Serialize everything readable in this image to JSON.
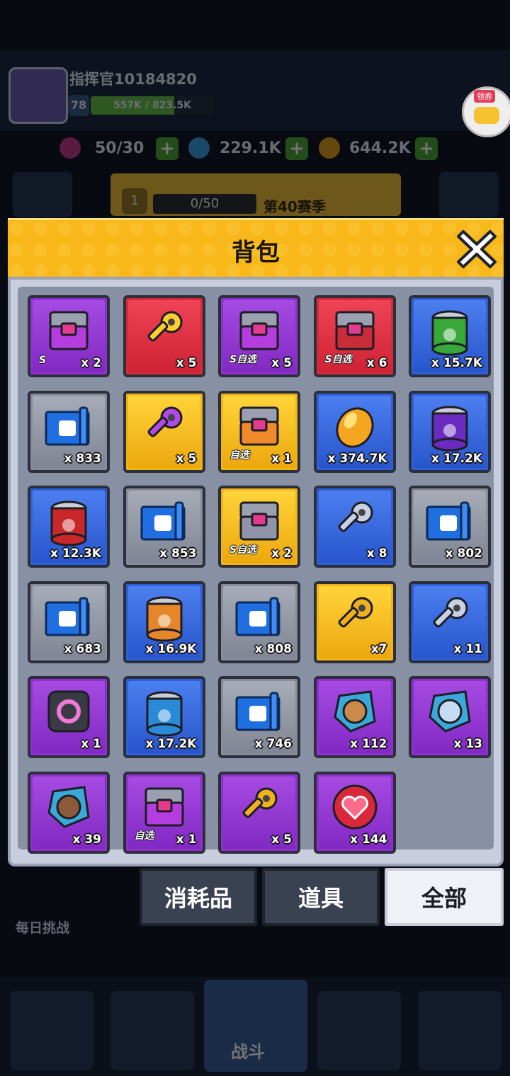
{
  "player": {
    "name": "指挥官10184820",
    "level": "78",
    "xp_text": "557K / 823.5K",
    "xp_fraction": 0.68
  },
  "resources": [
    {
      "icon": "energy-icon",
      "value": "50/30",
      "color": "#c43a8a"
    },
    {
      "icon": "diamond-icon",
      "value": "229.1K",
      "color": "#3aa0e8"
    },
    {
      "icon": "coin-icon",
      "value": "644.2K",
      "color": "#e0a020"
    }
  ],
  "gift": {
    "tag": "领券"
  },
  "season": {
    "level": "1",
    "progress": "0/50",
    "label": "第40赛季"
  },
  "backpack": {
    "title": "背包",
    "items": [
      {
        "icon": "s-chest-icon",
        "qty": "x 2",
        "tag": "S",
        "rarity": "purple"
      },
      {
        "icon": "scepter-key-icon",
        "qty": "x 5",
        "tag": "",
        "rarity": "red"
      },
      {
        "icon": "s-select-chest-icon",
        "qty": "x 5",
        "tag": "S自选",
        "rarity": "purple"
      },
      {
        "icon": "s-select-chest-red-icon",
        "qty": "x 6",
        "tag": "S自选",
        "rarity": "red"
      },
      {
        "icon": "green-leaf-can-icon",
        "qty": "x 15.7K",
        "tag": "",
        "rarity": "blue"
      },
      {
        "icon": "armor-blueprint-icon",
        "qty": "x 833",
        "tag": "",
        "rarity": "gray"
      },
      {
        "icon": "purple-key-icon",
        "qty": "x 5",
        "tag": "",
        "rarity": "gold"
      },
      {
        "icon": "orange-select-chest-icon",
        "qty": "x 1",
        "tag": "自选",
        "rarity": "gold"
      },
      {
        "icon": "gold-bean-icon",
        "qty": "x 374.7K",
        "tag": "",
        "rarity": "blue"
      },
      {
        "icon": "purple-moon-can-icon",
        "qty": "x 17.2K",
        "tag": "",
        "rarity": "blue"
      },
      {
        "icon": "red-fire-can-icon",
        "qty": "x 12.3K",
        "tag": "",
        "rarity": "blue"
      },
      {
        "icon": "boot-blueprint-icon",
        "qty": "x 853",
        "tag": "",
        "rarity": "gray"
      },
      {
        "icon": "gold-s-select-chest-icon",
        "qty": "x 2",
        "tag": "S自选",
        "rarity": "gold"
      },
      {
        "icon": "silver-ring-key-icon",
        "qty": "x 8",
        "tag": "",
        "rarity": "blue"
      },
      {
        "icon": "ring-blueprint-icon",
        "qty": "x 802",
        "tag": "",
        "rarity": "gray"
      },
      {
        "icon": "helmet-blueprint-icon",
        "qty": "x 683",
        "tag": "",
        "rarity": "gray"
      },
      {
        "icon": "orange-star-can-icon",
        "qty": "x 16.9K",
        "tag": "",
        "rarity": "blue"
      },
      {
        "icon": "glove-blueprint-icon",
        "qty": "x 808",
        "tag": "",
        "rarity": "gray"
      },
      {
        "icon": "gold-key-icon",
        "qty": "x7",
        "tag": "",
        "rarity": "gold"
      },
      {
        "icon": "silver-key-icon",
        "qty": "x 11",
        "tag": "",
        "rarity": "blue"
      },
      {
        "icon": "portal-device-icon",
        "qty": "x 1",
        "tag": "",
        "rarity": "purple"
      },
      {
        "icon": "blue-water-can-icon",
        "qty": "x 17.2K",
        "tag": "",
        "rarity": "blue"
      },
      {
        "icon": "gun-blueprint-icon",
        "qty": "x 746",
        "tag": "",
        "rarity": "gray"
      },
      {
        "icon": "hero-shard-plant-icon",
        "qty": "x 112",
        "tag": "",
        "rarity": "purple"
      },
      {
        "icon": "hero-shard-ice-icon",
        "qty": "x 13",
        "tag": "",
        "rarity": "purple"
      },
      {
        "icon": "hero-shard-raccoon-icon",
        "qty": "x 39",
        "tag": "",
        "rarity": "purple"
      },
      {
        "icon": "purple-select-chest-icon",
        "qty": "x 1",
        "tag": "自选",
        "rarity": "purple"
      },
      {
        "icon": "gold-key-purple-icon",
        "qty": "x 5",
        "tag": "",
        "rarity": "purple"
      },
      {
        "icon": "heart-icon",
        "qty": "x 144",
        "tag": "",
        "rarity": "purple"
      }
    ]
  },
  "tabs": [
    {
      "label": "消耗品",
      "active": false
    },
    {
      "label": "道具",
      "active": false
    },
    {
      "label": "全部",
      "active": true
    }
  ],
  "bg": {
    "daily_challenge": "每日挑战",
    "battle": "战斗"
  },
  "colors": {
    "header": "#f8b81a",
    "panel_bg": "#c8cedd",
    "purple": "#8e2fd0",
    "red": "#d42a3a",
    "blue": "#2f5fd8",
    "gray": "#878c99",
    "gold": "#f0b514"
  }
}
